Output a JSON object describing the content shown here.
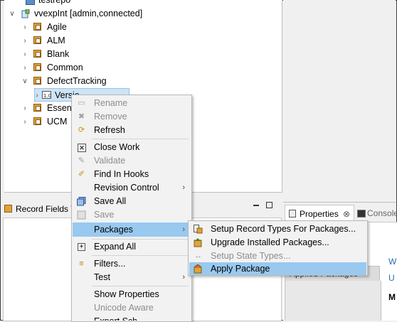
{
  "tree": {
    "items": [
      {
        "label": "testrepo",
        "expanded": null,
        "icon": "repository-icon"
      },
      {
        "label": "vvexpInt [admin,connected]",
        "expanded": true,
        "icon": "connection-icon"
      },
      {
        "label": "Agile",
        "expanded": false,
        "icon": "package-icon"
      },
      {
        "label": "ALM",
        "expanded": false,
        "icon": "package-icon"
      },
      {
        "label": "Blank",
        "expanded": false,
        "icon": "package-icon"
      },
      {
        "label": "Common",
        "expanded": false,
        "icon": "package-icon"
      },
      {
        "label": "DefectTracking",
        "expanded": true,
        "icon": "package-icon"
      },
      {
        "label": "Versio",
        "expanded": false,
        "icon": "version-icon"
      },
      {
        "label": "Essenti",
        "expanded": false,
        "icon": "package-icon"
      },
      {
        "label": "UCM",
        "expanded": false,
        "icon": "package-icon"
      }
    ]
  },
  "record_fields": {
    "tab_label": "Record Fields V"
  },
  "properties": {
    "tab_label": "Properties",
    "console_label": "Console",
    "applied_packages_header": "Applied Packages",
    "side_letters": [
      "W",
      "U",
      "M"
    ]
  },
  "context_menu": {
    "items": [
      {
        "label": "Rename",
        "enabled": false,
        "icon": "rename-icon"
      },
      {
        "label": "Remove",
        "enabled": false,
        "icon": "remove-icon"
      },
      {
        "label": "Refresh",
        "enabled": true,
        "icon": "refresh-icon"
      },
      {
        "label": "Close Work",
        "enabled": true,
        "icon": "close-work-icon"
      },
      {
        "label": "Validate",
        "enabled": false,
        "icon": "validate-icon"
      },
      {
        "label": "Find In Hooks",
        "enabled": true,
        "icon": "find-icon"
      },
      {
        "label": "Revision Control",
        "enabled": true,
        "submenu": true
      },
      {
        "label": "Save All",
        "enabled": true,
        "icon": "save-all-icon"
      },
      {
        "label": "Save",
        "enabled": false,
        "icon": "save-icon"
      },
      {
        "label": "Packages",
        "enabled": true,
        "submenu": true,
        "selected": true
      },
      {
        "label": "Expand All",
        "enabled": true,
        "icon": "expand-all-icon"
      },
      {
        "label": "Filters...",
        "enabled": true,
        "icon": "filter-icon"
      },
      {
        "label": "Test",
        "enabled": true,
        "submenu": true
      },
      {
        "label": "Show Properties",
        "enabled": true
      },
      {
        "label": "Unicode Aware",
        "enabled": false
      },
      {
        "label": "Export Sch",
        "enabled": true
      }
    ]
  },
  "packages_submenu": {
    "items": [
      {
        "label": "Setup Record Types For Packages...",
        "enabled": true,
        "icon": "setup-record-types-icon"
      },
      {
        "label": "Upgrade Installed Packages...",
        "enabled": true,
        "icon": "upgrade-icon"
      },
      {
        "label": "Setup State Types...",
        "enabled": false,
        "icon": "state-types-icon"
      },
      {
        "label": "Apply Package",
        "enabled": true,
        "selected": true,
        "icon": "apply-package-icon"
      }
    ]
  },
  "colors": {
    "selection": "#99c9ef",
    "menu_bg": "#f2f2f2"
  }
}
